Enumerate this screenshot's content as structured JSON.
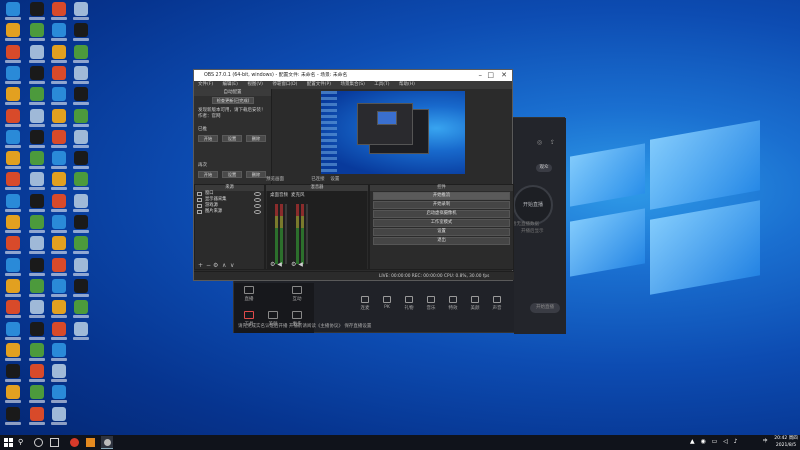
{
  "desktop": {
    "icon_rows": 20,
    "icons": [
      {
        "name": "edge-icon",
        "color": "#2a8ad8"
      },
      {
        "name": "qq-icon",
        "color": "#1a1a1a"
      },
      {
        "name": "wps-icon",
        "color": "#d84a2a"
      },
      {
        "name": "recycle-bin-icon",
        "color": "#9fb9d8"
      },
      {
        "name": "app-icon",
        "color": "#e2a020"
      },
      {
        "name": "chrome-icon",
        "color": "#4c9a3c"
      }
    ]
  },
  "obs": {
    "title": "OBS 27.0.1 (64-bit, windows) - 配置文件: 未命名 - 场景: 未命名",
    "menu": [
      "文件(F)",
      "编辑(E)",
      "视图(V)",
      "停靠窗口(D)",
      "配置文件(P)",
      "场景集合(S)",
      "工具(T)",
      "帮助(H)"
    ],
    "left_dock": {
      "title": "自动配置",
      "btn_wizard": "检查更新(已完成)",
      "notice": "发现新版本可用，请下载后安装！",
      "notice2": "作者：官网",
      "section1": "已推",
      "section2": "再次",
      "btn_a": "开始",
      "btn_b": "设置",
      "btn_c": "删除",
      "btn_d": "开始",
      "btn_e": "设置",
      "btn_f": "删除"
    },
    "preview_status": "预览画面",
    "preview_status2": "已连接",
    "preview_status3": "设置",
    "panels": {
      "sources_title": "来源",
      "mixer_title": "混音器",
      "mixer_ch1": "桌面音频",
      "mixer_ch2": "麦克风",
      "controls_title": "控件",
      "sources": [
        "窗口",
        "显示器采集",
        "游戏源",
        "图片来源"
      ],
      "controls": [
        "开始推流",
        "开始录制",
        "启动虚拟摄像机",
        "工作室模式",
        "设置",
        "退出"
      ]
    },
    "status_bar": "LIVE: 00:00:00   REC: 00:00:00   CPU: 0.8%, 30.00 fps"
  },
  "live_app": {
    "title_controls": "— □ ✕",
    "circle_label": "开始直播",
    "side_labels": [
      "设置",
      "直播间",
      "主播"
    ],
    "right_label": "观众",
    "side_text1": "暂无直播数据",
    "side_text2": "开播后显示",
    "tabs": [
      "直播",
      "互动",
      "工具",
      "美颜",
      "更多"
    ],
    "toolbar": [
      "连麦",
      "PK",
      "礼物",
      "音乐",
      "特效",
      "美颜",
      "声音"
    ],
    "start_btn": "开始直播",
    "status": "请先完成实名认证后开播   开播前请阅读《主播协议》   保存直播设置"
  },
  "taskbar": {
    "time": "20:42 周四",
    "date": "2021/8/5",
    "lang": "中"
  }
}
